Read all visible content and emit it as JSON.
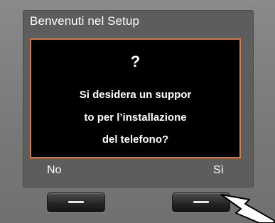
{
  "header": {
    "title": "Benvenuti nel Setup"
  },
  "dialog": {
    "symbol": "?",
    "lines": [
      "Si desidera un suppor",
      "to per l’installazione",
      "del telefono?"
    ]
  },
  "softkeys": {
    "left_label": "No",
    "right_label": "Sì"
  },
  "colors": {
    "dialog_border": "#d9783a",
    "screen_bg": "#5d5d5d",
    "dialog_bg": "#000000"
  },
  "icons": {
    "key_glyph": "minus-icon",
    "pointer": "pointer-arrow-icon"
  }
}
